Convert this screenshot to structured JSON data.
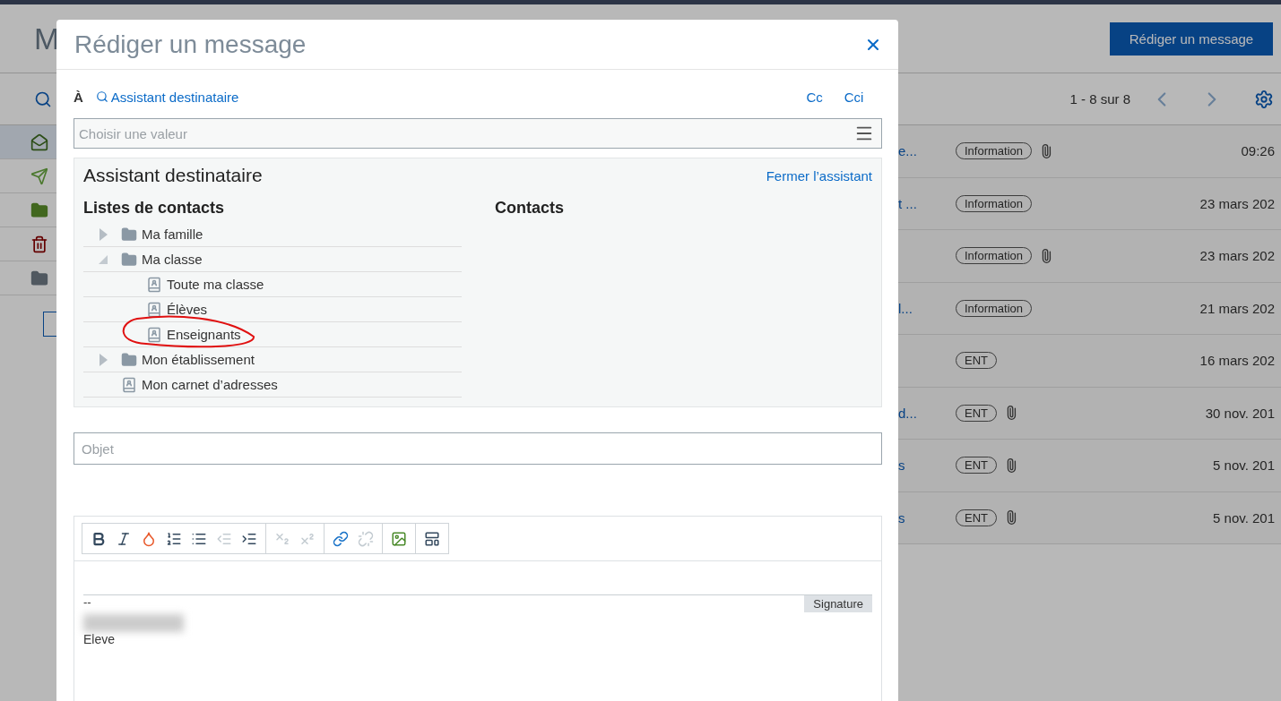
{
  "page": {
    "title": "M",
    "compose_button": "Rédiger un message",
    "pagination": "1 - 8 sur 8"
  },
  "sidebar": {
    "items": [
      {
        "kind": "inbox",
        "selected": true
      },
      {
        "kind": "sent",
        "selected": false
      },
      {
        "kind": "folder",
        "selected": false
      },
      {
        "kind": "trash",
        "selected": false
      },
      {
        "kind": "other",
        "selected": false
      }
    ]
  },
  "messages": [
    {
      "subject": "e...",
      "tag": "Information",
      "attachment": true,
      "date": "09:26"
    },
    {
      "subject": "t ...",
      "tag": "Information",
      "attachment": false,
      "date": "23 mars 202"
    },
    {
      "tag": "Information",
      "attachment": true,
      "date": "23 mars 202"
    },
    {
      "subject": "l...",
      "tag": "Information",
      "attachment": false,
      "date": "21 mars 202"
    },
    {
      "tag": "ENT",
      "attachment": false,
      "date": "16 mars 202"
    },
    {
      "subject": "d...",
      "tag": "ENT",
      "attachment": true,
      "date": "30 nov. 201"
    },
    {
      "subject": "s",
      "tag": "ENT",
      "attachment": true,
      "date": "5 nov. 201"
    },
    {
      "subject": "s",
      "tag": "ENT",
      "attachment": true,
      "date": "5 nov. 201"
    }
  ],
  "dialog": {
    "title": "Rédiger un message",
    "to_label": "À",
    "assistant_link": "Assistant destinataire",
    "cc": "Cc",
    "cci": "Cci",
    "recipients": {
      "placeholder": "Choisir une valeur"
    },
    "assistant": {
      "title": "Assistant destinataire",
      "close_link": "Fermer l’assistant",
      "lists_heading": "Listes de contacts",
      "contacts_heading": "Contacts",
      "tree": [
        {
          "label": "Ma famille",
          "kind": "folder",
          "expanded": false
        },
        {
          "label": "Ma classe",
          "kind": "folder",
          "expanded": true,
          "children": [
            {
              "label": "Toute ma classe",
              "kind": "list"
            },
            {
              "label": "Élèves",
              "kind": "list"
            },
            {
              "label": "Enseignants",
              "kind": "list",
              "annotated": true
            }
          ]
        },
        {
          "label": "Mon établissement",
          "kind": "folder",
          "expanded": false
        },
        {
          "label": "Mon carnet d’adresses",
          "kind": "list"
        }
      ]
    },
    "subject": {
      "placeholder": "Objet"
    },
    "editor": {
      "toolbar": [
        [
          {
            "kind": "bold",
            "disabled": false
          },
          {
            "kind": "italic",
            "disabled": false
          },
          {
            "kind": "color",
            "disabled": false
          },
          {
            "kind": "ordered-list",
            "disabled": false
          },
          {
            "kind": "bullet-list",
            "disabled": false
          },
          {
            "kind": "outdent",
            "disabled": true
          },
          {
            "kind": "indent",
            "disabled": false
          }
        ],
        [
          {
            "kind": "subscript",
            "disabled": true
          },
          {
            "kind": "superscript",
            "disabled": true
          }
        ],
        [
          {
            "kind": "link",
            "disabled": false
          },
          {
            "kind": "unlink",
            "disabled": true
          }
        ],
        [
          {
            "kind": "image",
            "disabled": false
          }
        ],
        [
          {
            "kind": "template",
            "disabled": false
          }
        ]
      ],
      "signature_separator": "--",
      "signature_label": "Signature",
      "signature_line": "Eleve"
    }
  }
}
